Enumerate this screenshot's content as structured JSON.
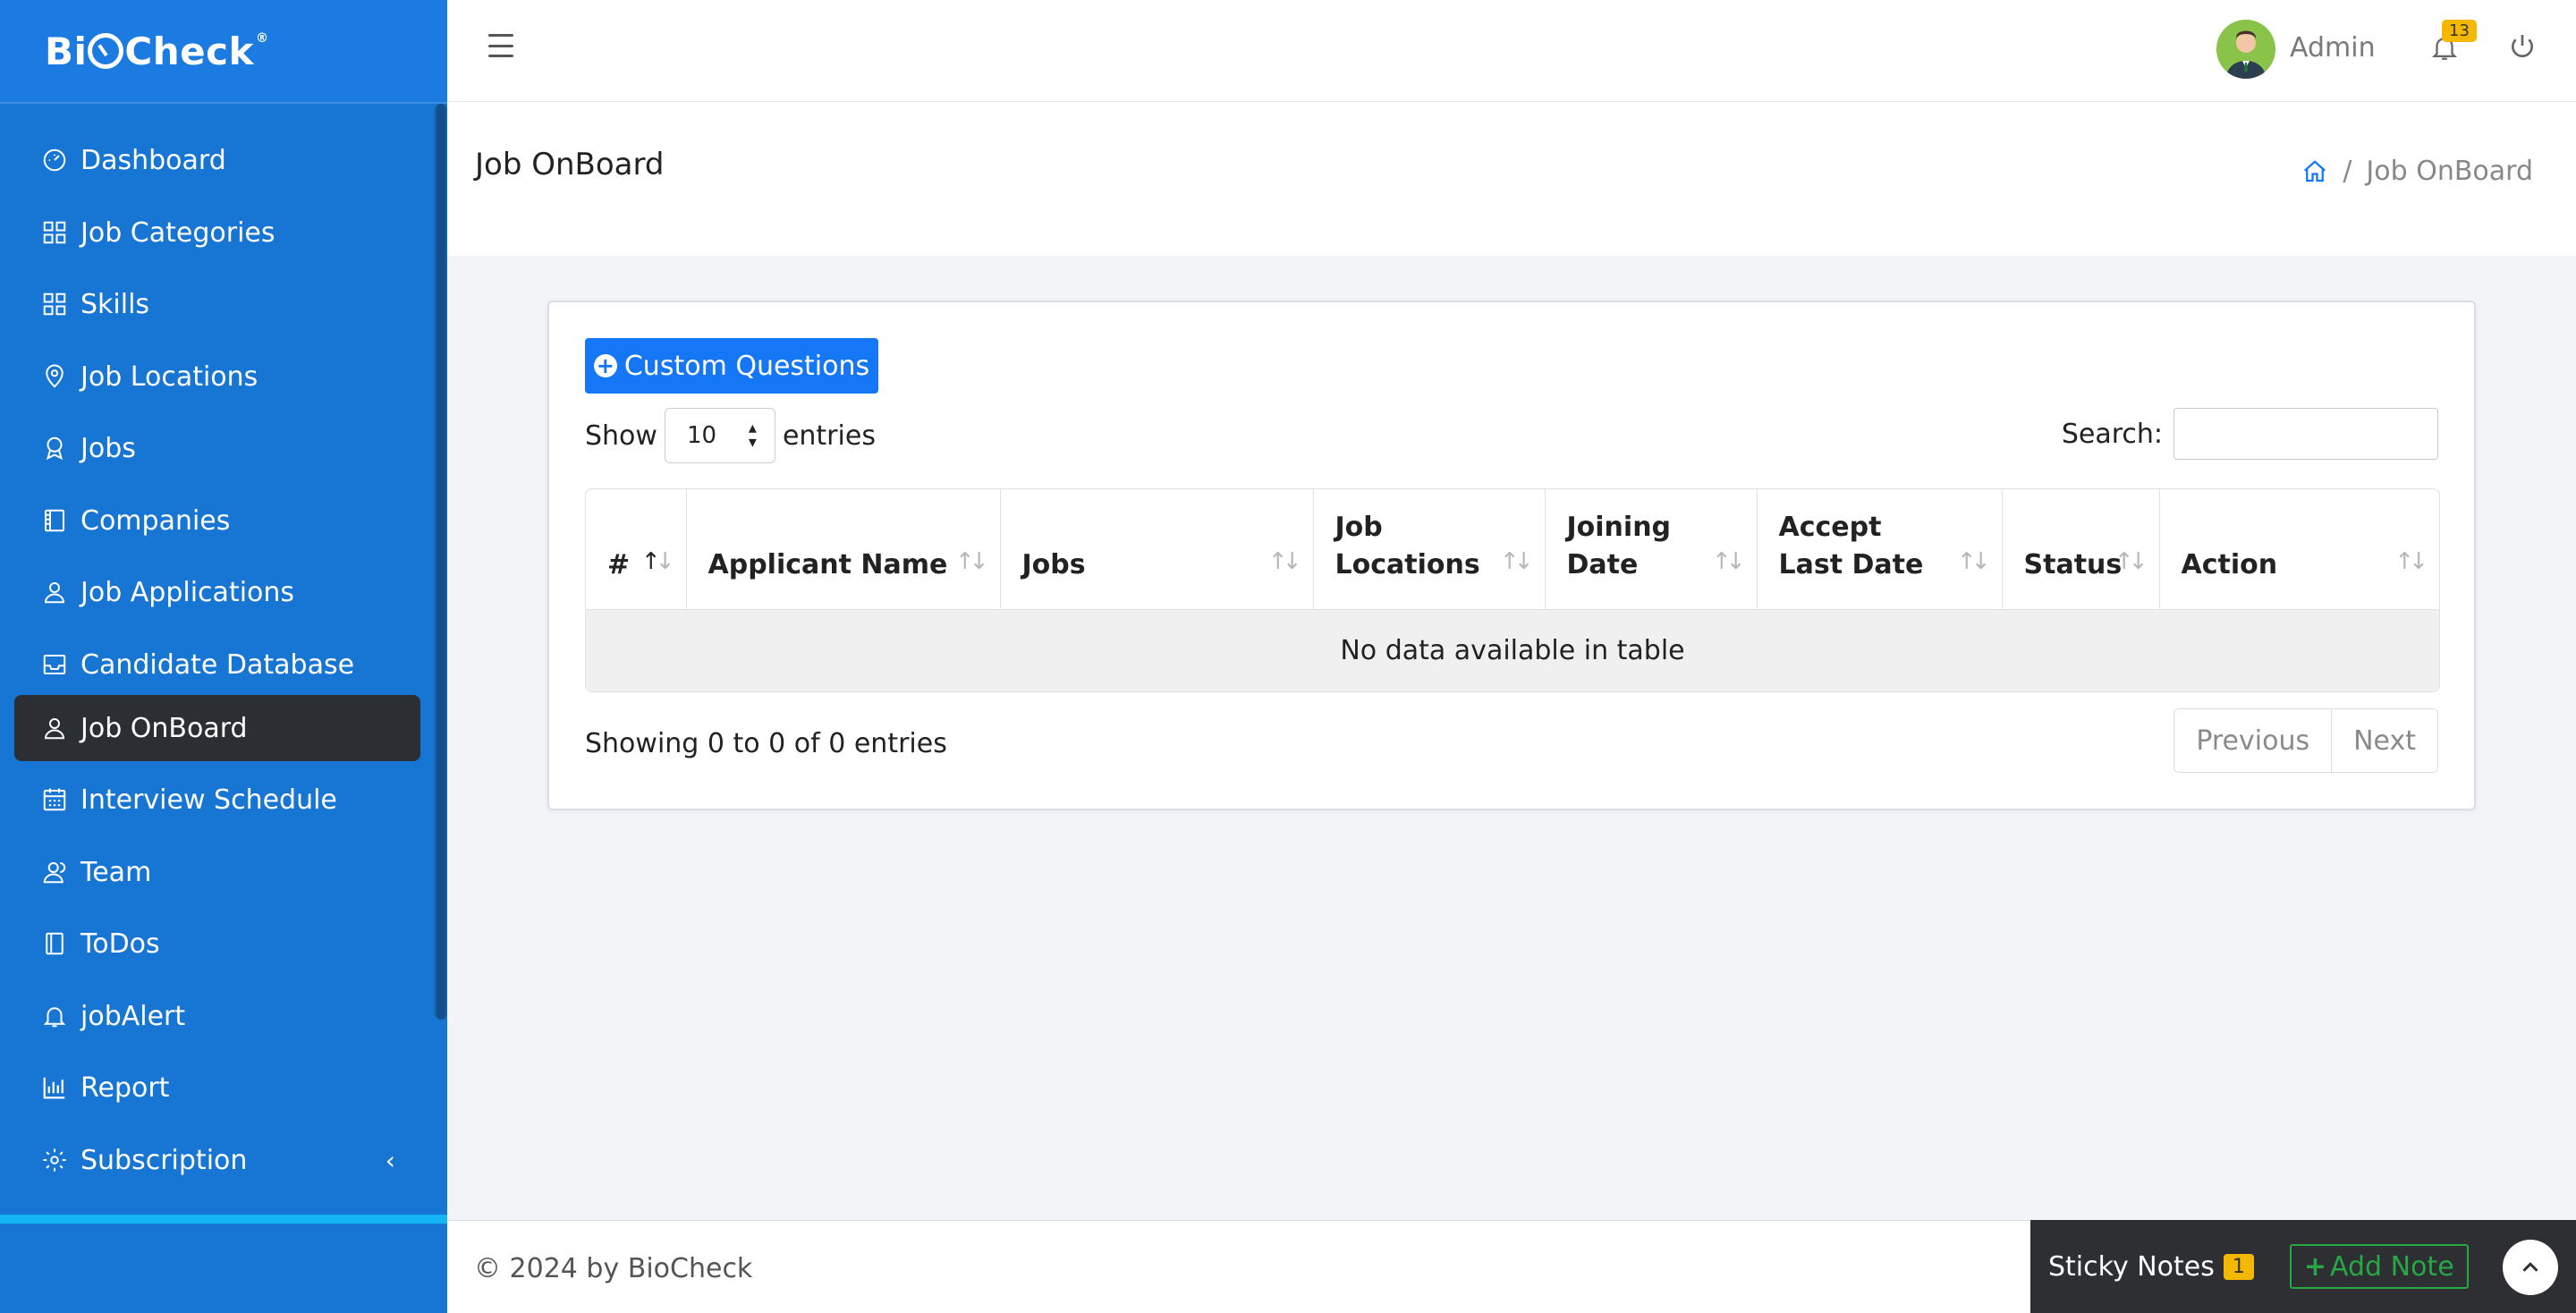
{
  "brand": {
    "name_part1": "Bi",
    "name_part2": "Check",
    "registered": "®"
  },
  "sidebar": {
    "items": [
      {
        "label": "Dashboard",
        "icon": "speedometer-icon"
      },
      {
        "label": "Job Categories",
        "icon": "grid-icon"
      },
      {
        "label": "Skills",
        "icon": "grid-icon"
      },
      {
        "label": "Job Locations",
        "icon": "location-pin-icon"
      },
      {
        "label": "Jobs",
        "icon": "badge-icon"
      },
      {
        "label": "Companies",
        "icon": "building-icon"
      },
      {
        "label": "Job Applications",
        "icon": "user-icon"
      },
      {
        "label": "Candidate Database",
        "icon": "inbox-icon"
      },
      {
        "label": "Job OnBoard",
        "icon": "user-icon",
        "active": true
      },
      {
        "label": "Interview Schedule",
        "icon": "calendar-icon"
      },
      {
        "label": "Team",
        "icon": "team-icon"
      },
      {
        "label": "ToDos",
        "icon": "notebook-icon"
      },
      {
        "label": "jobAlert",
        "icon": "bell-icon"
      },
      {
        "label": "Report",
        "icon": "bar-chart-icon"
      },
      {
        "label": "Subscription",
        "icon": "gear-icon",
        "chevron": "‹"
      }
    ]
  },
  "header": {
    "user_name": "Admin",
    "notification_count": "13"
  },
  "page": {
    "title": "Job OnBoard",
    "breadcrumb_current": "Job OnBoard",
    "breadcrumb_sep": "/"
  },
  "toolbar": {
    "custom_questions_label": "Custom Questions",
    "show_label": "Show",
    "entries_value": "10",
    "entries_label": "entries",
    "search_label": "Search:",
    "search_value": ""
  },
  "table": {
    "columns": [
      "#",
      "Applicant Name",
      "Jobs",
      "Job Locations",
      "Joining Date",
      "Accept Last Date",
      "Status",
      "Action"
    ],
    "empty_message": "No data available in table",
    "info": "Showing 0 to 0 of 0 entries",
    "prev_label": "Previous",
    "next_label": "Next"
  },
  "footer": {
    "copyright": "© 2024 by BioCheck",
    "sticky_label": "Sticky Notes",
    "sticky_count": "1",
    "add_note_label": "Add Note"
  },
  "colors": {
    "sidebar_bg": "#1775d4",
    "active_item_bg": "#2b2f33",
    "primary_button": "#1577f5",
    "badge_yellow": "#f5b800",
    "add_note_green": "#28a745"
  }
}
